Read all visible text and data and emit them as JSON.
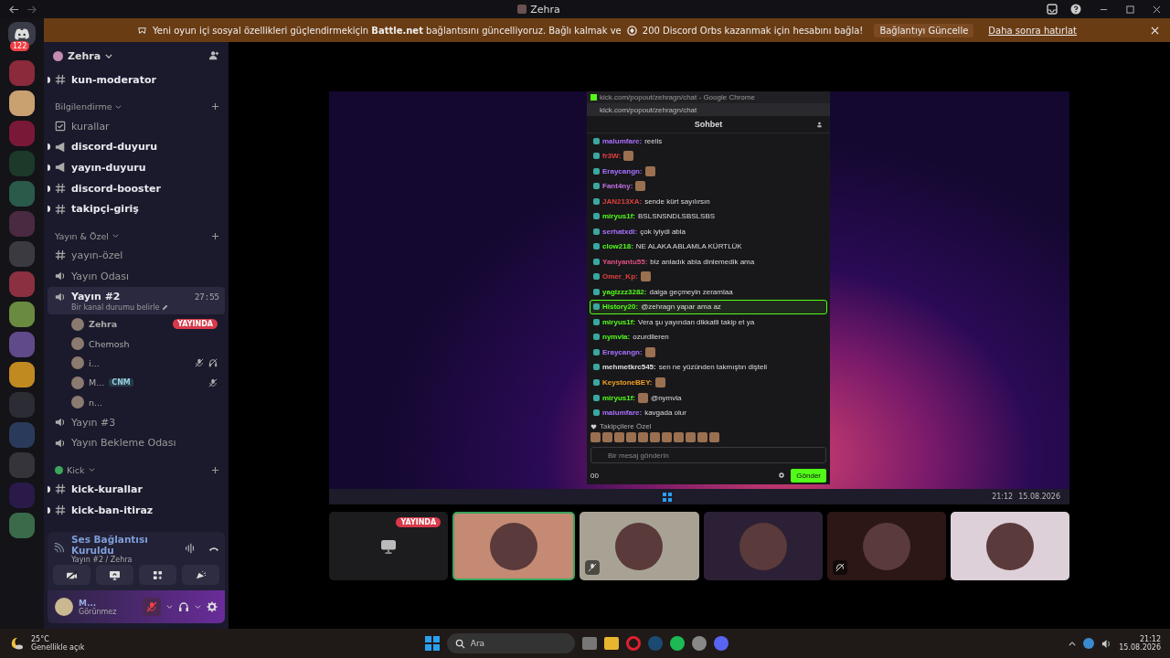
{
  "title_bar": {
    "title": "Zehra"
  },
  "banner": {
    "text": "Yeni oyun içi sosyal özellikleri güçlendirmekiçin **Battle.net** bağlantısını güncelliyoruz. Bağlı kalmak ve",
    "orbs": "200 Discord Orbs kazanmak için hesabını bağla!",
    "action": "Bağlantıyı Güncelle",
    "later": "Daha sonra hatırlat"
  },
  "server_rail": {
    "badge": "122"
  },
  "sidebar": {
    "server_name": "Zehra",
    "items": [
      {
        "kind": "text",
        "name": "kun-moderator",
        "unread": true
      },
      {
        "kind": "category",
        "name": "Bilgilendirme"
      },
      {
        "kind": "rules",
        "name": "kurallar",
        "unread": false
      },
      {
        "kind": "announcement",
        "name": "discord-duyuru",
        "unread": true
      },
      {
        "kind": "announcement",
        "name": "yayın-duyuru",
        "unread": true
      },
      {
        "kind": "text",
        "name": "discord-booster",
        "unread": true
      },
      {
        "kind": "text",
        "name": "takipçi-giriş",
        "unread": true
      },
      {
        "kind": "category",
        "name": "Yayın & Özel"
      },
      {
        "kind": "text",
        "name": "yayın-özel",
        "unread": false
      },
      {
        "kind": "voice",
        "name": "Yayın Odası",
        "selected": false
      },
      {
        "kind": "voice",
        "name": "Yayın #2",
        "selected": true,
        "timer": "27:55",
        "status": "Bir kanal durumu belirle",
        "users": [
          {
            "name": "Zehra",
            "live": "YAYINDA",
            "muted": false,
            "deafened": false
          },
          {
            "name": "Chemosh",
            "muted": false,
            "deafened": false
          },
          {
            "name": "i...",
            "muted": true,
            "deafened": true
          },
          {
            "name": "M...",
            "tag": "CNM",
            "muted": true,
            "deafened": false
          },
          {
            "name": "n...",
            "muted": false,
            "deafened": false
          }
        ]
      },
      {
        "kind": "voice",
        "name": "Yayın #3",
        "selected": false
      },
      {
        "kind": "voice",
        "name": "Yayın Bekleme Odası",
        "selected": false
      },
      {
        "kind": "category",
        "name": "Kick",
        "color": "#3ba55c"
      },
      {
        "kind": "text",
        "name": "kick-kurallar",
        "unread": true
      },
      {
        "kind": "text",
        "name": "kick-ban-itiraz",
        "unread": true
      }
    ]
  },
  "voice_panel": {
    "status": "Ses Bağlantısı Kuruldu",
    "channel": "Yayın #2 / Zehra"
  },
  "user_panel": {
    "name": "M...",
    "status": "Görünmez",
    "mic_muted": true
  },
  "shared_screen": {
    "window_title": "kick.com/popout/zehragn/chat - Google Chrome",
    "url": "kick.com/popout/zehragn/chat",
    "header": "Sohbet",
    "messages": [
      {
        "user": "malumfare:",
        "color": "#a970ff",
        "text": "reelis",
        "emote": false,
        "highlighted": false
      },
      {
        "user": "fr3W:",
        "color": "#e0403c",
        "emote": true,
        "highlighted": false
      },
      {
        "user": "Eraycangn:",
        "color": "#a970ff",
        "emote": true,
        "highlighted": false
      },
      {
        "user": "Fant4ny:",
        "color": "#c070e0",
        "emote": true,
        "highlighted": false
      },
      {
        "user": "JAN213XA:",
        "color": "#e0403c",
        "text": "sende kürt sayılırsın",
        "emote": false,
        "highlighted": false
      },
      {
        "user": "miryus1f:",
        "color": "#53fc18",
        "text": "BSLSNSNDLSBSLSBS",
        "emote": false,
        "highlighted": false
      },
      {
        "user": "serhatxdi:",
        "color": "#a970ff",
        "text": "çok iyiydi abla",
        "emote": false,
        "highlighted": false
      },
      {
        "user": "clow218:",
        "color": "#53fc18",
        "text": "NE ALAKA ABLAMLA KÜRTLÜK",
        "emote": false,
        "highlighted": false
      },
      {
        "user": "Yaniyantu55:",
        "color": "#e05080",
        "text": "biz anladık abla dinlemedik ama",
        "emote": false,
        "highlighted": false
      },
      {
        "user": "Omer_Kp:",
        "color": "#e0403c",
        "emote": true,
        "highlighted": false
      },
      {
        "user": "yagizzz3282:",
        "color": "#53fc18",
        "text": "dalga geçmeyin zeramlaa",
        "emote": false,
        "highlighted": false
      },
      {
        "user": "History20:",
        "color": "#53fc18",
        "text": "@zehragn yapar ama az",
        "emote": false,
        "highlighted": true
      },
      {
        "user": "miryus1f:",
        "color": "#53fc18",
        "text": "Vera şu yayından dikkatli takip et ya",
        "emote": false,
        "highlighted": false
      },
      {
        "user": "nymvla:",
        "color": "#53fc18",
        "text": "ozurdileren",
        "emote": false,
        "highlighted": false
      },
      {
        "user": "Eraycangn:",
        "color": "#a970ff",
        "emote": true,
        "highlighted": false
      },
      {
        "user": "mehmetkrc545:",
        "color": "#e0e0e0",
        "text": "sen ne yüzünden takmıştın dişteli",
        "emote": false,
        "highlighted": false
      },
      {
        "user": "KeystoneBEY:",
        "color": "#f0a020",
        "emote": true,
        "highlighted": false
      },
      {
        "user": "miryus1f:",
        "color": "#53fc18",
        "text": "@nymvla",
        "emote": true,
        "highlighted": false
      },
      {
        "user": "malumfare:",
        "color": "#a970ff",
        "text": "kavgada olur",
        "emote": false,
        "highlighted": false
      }
    ],
    "emote_section": "Takipçilere Özel",
    "input_placeholder": "Bir mesaj gönderin",
    "viewer_count": "00",
    "send": "Gönder",
    "time": "21:12",
    "date": "15.08.2026"
  },
  "tiles": [
    {
      "kind": "screen",
      "live": "YAYINDA",
      "selected": false,
      "muted": false,
      "deafened": false,
      "color": "#1c1c1f"
    },
    {
      "kind": "avatar",
      "selected": true,
      "muted": false,
      "deafened": false,
      "color": "#c48a74"
    },
    {
      "kind": "avatar",
      "selected": false,
      "muted": true,
      "deafened": false,
      "color": "#a8a294"
    },
    {
      "kind": "avatar",
      "selected": false,
      "muted": false,
      "deafened": false,
      "color": "#2c2036"
    },
    {
      "kind": "avatar",
      "selected": false,
      "muted": false,
      "deafened": true,
      "color": "#2c1616"
    },
    {
      "kind": "avatar",
      "selected": false,
      "muted": false,
      "deafened": false,
      "color": "#ddd0d8"
    }
  ],
  "taskbar": {
    "temperature": "25°C",
    "weather": "Genellikle açık",
    "search_placeholder": "Ara",
    "time": "21:12",
    "date": "15.08.2026"
  }
}
